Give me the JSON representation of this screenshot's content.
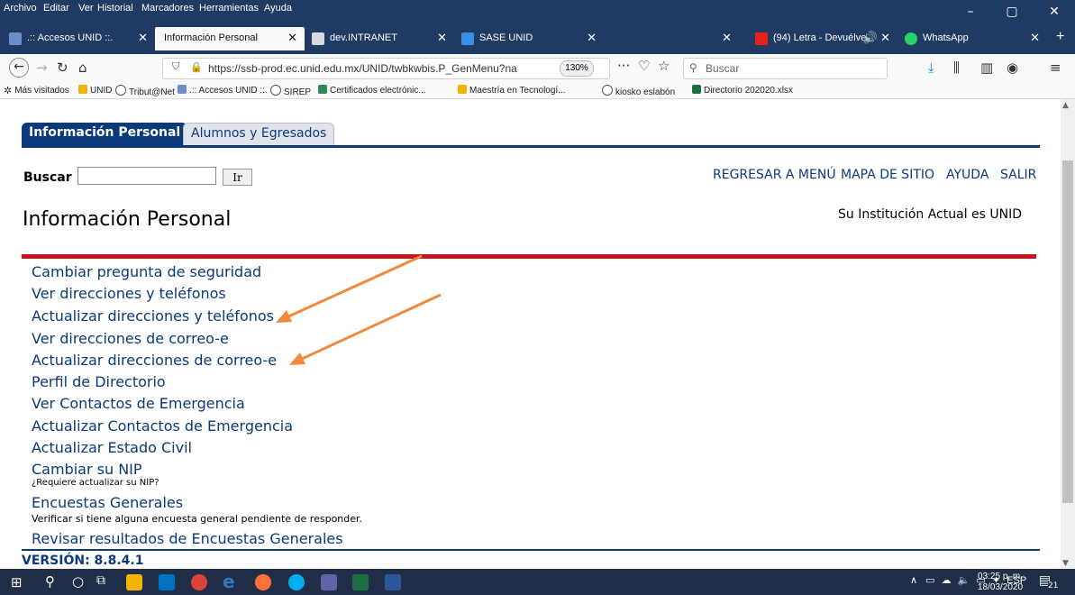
{
  "menubar": {
    "items": [
      "Archivo",
      "Editar",
      "Ver",
      "Historial",
      "Marcadores",
      "Herramientas",
      "Ayuda"
    ]
  },
  "browser_tabs": [
    {
      "label": ".:: Accesos UNID ::.",
      "icon": "unid-icon",
      "active": false
    },
    {
      "label": "Información Personal",
      "icon": "",
      "active": true
    },
    {
      "label": "dev.INTRANET",
      "icon": "intranet-icon",
      "active": false
    },
    {
      "label": "SASE UNID",
      "icon": "sase-icon",
      "active": false
    },
    {
      "label": "(94) Letra - Devuélve",
      "icon": "youtube-icon",
      "active": false
    },
    {
      "label": "WhatsApp",
      "icon": "whatsapp-icon",
      "active": false
    }
  ],
  "navbar": {
    "url": "https://ssb-prod.ec.unid.edu.mx/UNID/twbkwbis.P_GenMenu?na",
    "zoom": "130%",
    "search_placeholder": "Buscar"
  },
  "bookmarks": [
    "Más visitados",
    "UNID",
    "Tribut@Net",
    ".:: Accesos UNID ::.",
    "SIREP",
    "Certificados electrónic...",
    "Maestría en Tecnologí...",
    "kiosko eslabón",
    "Directorio 202020.xlsx"
  ],
  "page": {
    "tabs": [
      "Información Personal",
      "Alumnos y Egresados"
    ],
    "search_label": "Buscar",
    "search_button": "Ir",
    "top_links": [
      "REGRESAR A MENÚ",
      "MAPA DE SITIO",
      "AYUDA",
      "SALIR"
    ],
    "title": "Información Personal",
    "institution": "Su Institución Actual es UNID",
    "menu": [
      {
        "label": "Cambiar pregunta de seguridad"
      },
      {
        "label": "Ver direcciones y teléfonos"
      },
      {
        "label": "Actualizar direcciones y teléfonos"
      },
      {
        "label": "Ver direcciones de correo-e"
      },
      {
        "label": "Actualizar direcciones de correo-e"
      },
      {
        "label": "Perfil de Directorio"
      },
      {
        "label": "Ver Contactos de Emergencia"
      },
      {
        "label": "Actualizar Contactos de Emergencia"
      },
      {
        "label": "Actualizar Estado Civil"
      },
      {
        "label": "Cambiar su NIP",
        "desc": "¿Requiere actualizar su NIP?"
      },
      {
        "label": "Encuestas Generales",
        "desc": "Verificar si tiene alguna encuesta general pendiente de responder."
      },
      {
        "label": "Revisar resultados de Encuestas Generales"
      }
    ],
    "version": "VERSIÓN: 8.8.4.1",
    "accent_color": "#0b3a7a",
    "rule_color": "#c8161e",
    "arrow_color": "#f08a3c"
  },
  "taskbar": {
    "language": "ESP",
    "time": "03:25 p. m.",
    "date": "18/03/2020",
    "notifications": "21"
  }
}
